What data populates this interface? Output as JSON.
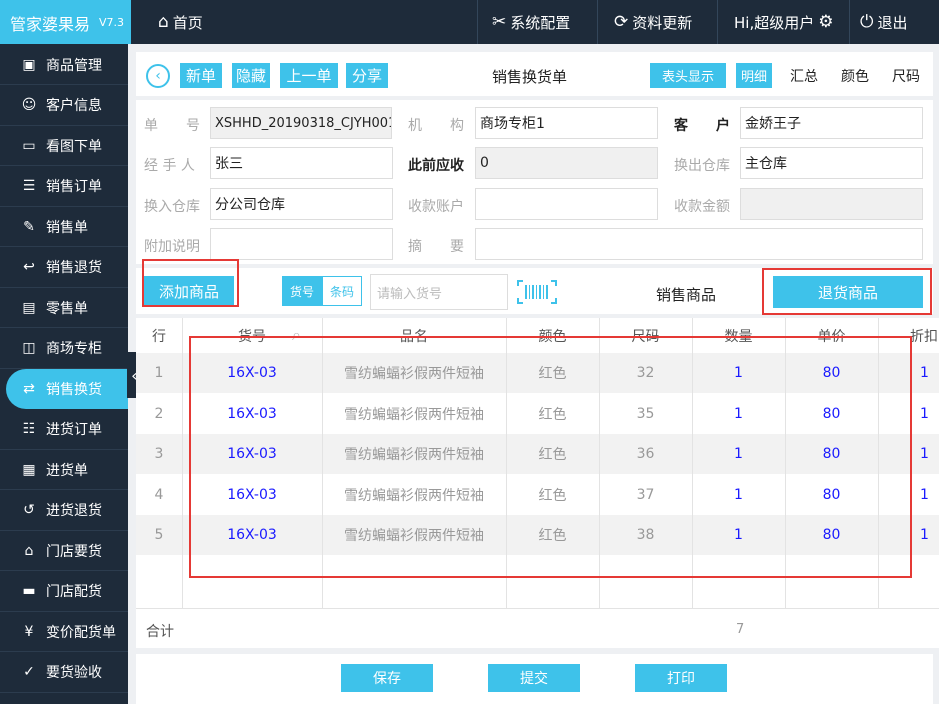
{
  "brand": {
    "name": "管家婆果易",
    "version": "V7.3"
  },
  "topnav": {
    "home": "首页",
    "system_config": "系统配置",
    "data_update": "资料更新",
    "user": "Hi,超级用户",
    "logout": "退出"
  },
  "sidebar": {
    "items": [
      {
        "label": "商品管理",
        "icon": "box-icon"
      },
      {
        "label": "客户信息",
        "icon": "person-icon"
      },
      {
        "label": "看图下单",
        "icon": "image-icon"
      },
      {
        "label": "销售订单",
        "icon": "order-icon"
      },
      {
        "label": "销售单",
        "icon": "sale-icon"
      },
      {
        "label": "销售退货",
        "icon": "return-icon"
      },
      {
        "label": "零售单",
        "icon": "receipt-icon"
      },
      {
        "label": "商场专柜",
        "icon": "bag-icon"
      },
      {
        "label": "销售换货",
        "icon": "exchange-icon"
      },
      {
        "label": "进货订单",
        "icon": "purchase-order-icon"
      },
      {
        "label": "进货单",
        "icon": "purchase-icon"
      },
      {
        "label": "进货退货",
        "icon": "purchase-return-icon"
      },
      {
        "label": "门店要货",
        "icon": "store-icon"
      },
      {
        "label": "门店配货",
        "icon": "truck-icon"
      },
      {
        "label": "变价配货单",
        "icon": "price-change-icon"
      },
      {
        "label": "要货验收",
        "icon": "inspect-icon"
      }
    ],
    "active_index": 8
  },
  "toolbar": {
    "new": "新单",
    "hide": "隐藏",
    "prev": "上一单",
    "share": "分享",
    "title": "销售换货单",
    "header_display": "表头显示",
    "detail": "明细",
    "summary": "汇总",
    "color": "颜色",
    "size": "尺码"
  },
  "form": {
    "doc_no_label": "单　　号",
    "doc_no": "XSHHD_20190318_CJYH001",
    "org_label": "机　　构",
    "org": "商场专柜1",
    "customer_label": "客　　户",
    "customer": "金娇王子",
    "handler_label": "经 手 人",
    "handler": "张三",
    "prev_receivable_label": "此前应收",
    "prev_receivable": "0",
    "out_warehouse_label": "换出仓库",
    "out_warehouse": "主仓库",
    "in_warehouse_label": "换入仓库",
    "in_warehouse": "分公司仓库",
    "account_label": "收款账户",
    "account": "",
    "amount_label": "收款金额",
    "amount": "",
    "note_label": "附加说明",
    "note": "",
    "summary_label": "摘　　要",
    "summary": ""
  },
  "addbar": {
    "add_goods": "添加商品",
    "seg_code": "货号",
    "seg_barcode": "条码",
    "search_placeholder": "请输入货号",
    "sales_goods": "销售商品",
    "return_goods": "退货商品"
  },
  "table": {
    "headers": {
      "idx": "行",
      "code": "货号",
      "name": "品名",
      "color": "颜色",
      "size": "尺码",
      "qty": "数量",
      "price": "单价",
      "disc": "折扣"
    },
    "rows": [
      {
        "idx": "1",
        "code": "16X-03",
        "name": "雪纺蝙蝠衫假两件短袖",
        "color": "红色",
        "size": "32",
        "qty": "1",
        "price": "80",
        "disc": "1"
      },
      {
        "idx": "2",
        "code": "16X-03",
        "name": "雪纺蝙蝠衫假两件短袖",
        "color": "红色",
        "size": "35",
        "qty": "1",
        "price": "80",
        "disc": "1"
      },
      {
        "idx": "3",
        "code": "16X-03",
        "name": "雪纺蝙蝠衫假两件短袖",
        "color": "红色",
        "size": "36",
        "qty": "1",
        "price": "80",
        "disc": "1"
      },
      {
        "idx": "4",
        "code": "16X-03",
        "name": "雪纺蝙蝠衫假两件短袖",
        "color": "红色",
        "size": "37",
        "qty": "1",
        "price": "80",
        "disc": "1"
      },
      {
        "idx": "5",
        "code": "16X-03",
        "name": "雪纺蝙蝠衫假两件短袖",
        "color": "红色",
        "size": "38",
        "qty": "1",
        "price": "80",
        "disc": "1"
      }
    ],
    "total_label": "合计",
    "total_qty": "7"
  },
  "bottom": {
    "save": "保存",
    "submit": "提交",
    "print": "打印"
  },
  "colors": {
    "accent": "#3ec2ea",
    "dark": "#1e2b3a",
    "highlight": "#e53935"
  }
}
